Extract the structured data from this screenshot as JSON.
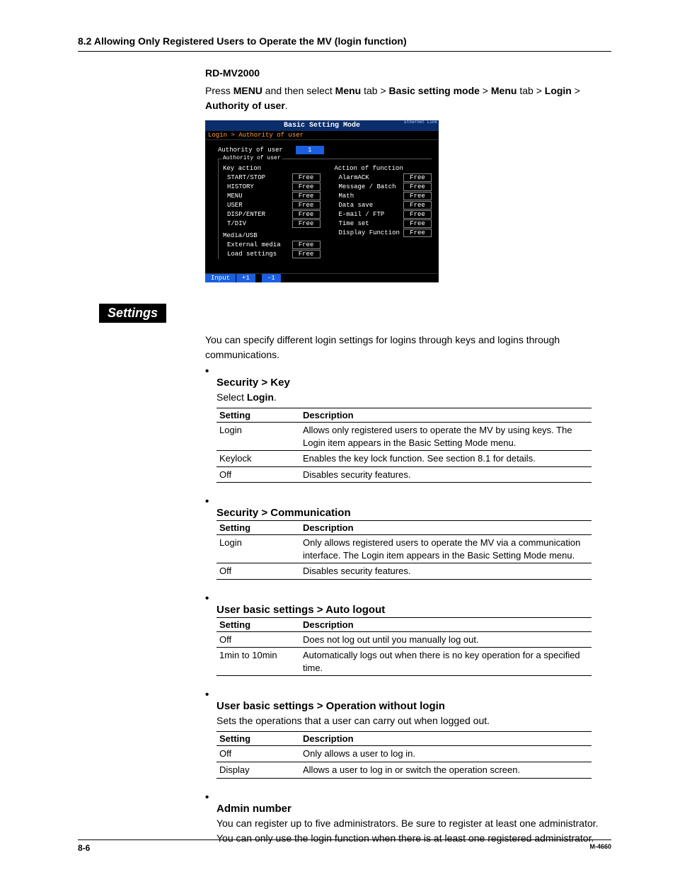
{
  "header": {
    "title": "8.2  Allowing Only Registered Users to Operate the MV (login function)"
  },
  "intro": {
    "model": "RD-MV2000",
    "press": "Press ",
    "menu1": "MENU",
    "mid1": " and then select ",
    "menu2": "Menu",
    "mid2": " tab > ",
    "bsm": "Basic setting mode",
    "mid3": " > ",
    "menu3": "Menu",
    "mid4": " tab > ",
    "login": "Login",
    "mid5": " > ",
    "auth": "Authority of user",
    "dot": "."
  },
  "shot": {
    "title": "Basic Setting Mode",
    "eth": "Ethernet\nLink",
    "crumb": "Login > Authority of user",
    "auth_label": "Authority of user",
    "auth_value": "1",
    "group_label": "Authority of user",
    "left_header": "Key action",
    "right_header": "Action of function",
    "left_items": [
      {
        "lbl": "START/STOP",
        "val": "Free"
      },
      {
        "lbl": "HISTORY",
        "val": "Free"
      },
      {
        "lbl": "MENU",
        "val": "Free"
      },
      {
        "lbl": "USER",
        "val": "Free"
      },
      {
        "lbl": "DISP/ENTER",
        "val": "Free"
      },
      {
        "lbl": "T/DIV",
        "val": "Free"
      }
    ],
    "media_header": "Media/USB",
    "media_items": [
      {
        "lbl": "External media",
        "val": "Free"
      },
      {
        "lbl": "Load settings",
        "val": "Free"
      }
    ],
    "right_items": [
      {
        "lbl": "AlarmACK",
        "val": "Free"
      },
      {
        "lbl": "Message / Batch",
        "val": "Free"
      },
      {
        "lbl": "Math",
        "val": "Free"
      },
      {
        "lbl": "Data save",
        "val": "Free"
      },
      {
        "lbl": "E-mail / FTP",
        "val": "Free"
      },
      {
        "lbl": "Time set",
        "val": "Free"
      },
      {
        "lbl": "Display Function",
        "val": "Free"
      }
    ],
    "footer": {
      "input": "Input",
      "plus": "+1",
      "minus": "-1"
    }
  },
  "settings_tab": "Settings",
  "settings_intro": "You can specify different login settings for logins through keys and logins through communications.",
  "sec_key": {
    "title": "Security > Key",
    "sub_pre": "Select ",
    "sub_bold": "Login",
    "sub_post": ".",
    "th1": "Setting",
    "th2": "Description",
    "rows": [
      {
        "k": "Login",
        "v": "Allows only registered users to operate the MV by using keys. The Login item appears in the Basic Setting Mode menu."
      },
      {
        "k": "Keylock",
        "v": "Enables the key lock function. See section 8.1 for details."
      },
      {
        "k": "Off",
        "v": "Disables security features."
      }
    ]
  },
  "sec_comm": {
    "title": "Security > Communication",
    "th1": "Setting",
    "th2": "Description",
    "rows": [
      {
        "k": "Login",
        "v": "Only allows registered users to operate the MV via a communication interface. The Login item appears in the Basic Setting Mode menu."
      },
      {
        "k": "Off",
        "v": "Disables security features."
      }
    ]
  },
  "sec_auto": {
    "title": "User basic settings > Auto logout",
    "th1": "Setting",
    "th2": "Description",
    "rows": [
      {
        "k": "Off",
        "v": "Does not log out until you manually log out."
      },
      {
        "k": "1min to 10min",
        "v": "Automatically logs out when there is no key operation for a specified time."
      }
    ]
  },
  "sec_op": {
    "title": "User basic settings > Operation without login",
    "pre": "Sets the operations that a user can carry out when logged out.",
    "th1": "Setting",
    "th2": "Description",
    "rows": [
      {
        "k": "Off",
        "v": "Only allows a user to log in."
      },
      {
        "k": "Display",
        "v": "Allows a user to log in or switch the operation screen."
      }
    ]
  },
  "sec_admin": {
    "title": "Admin number",
    "body": "You can register up to five administrators. Be sure to register at least one administrator. You can only use the login function when there is at least one registered administrator."
  },
  "footer": {
    "page": "8-6",
    "doc": "M-4660"
  }
}
